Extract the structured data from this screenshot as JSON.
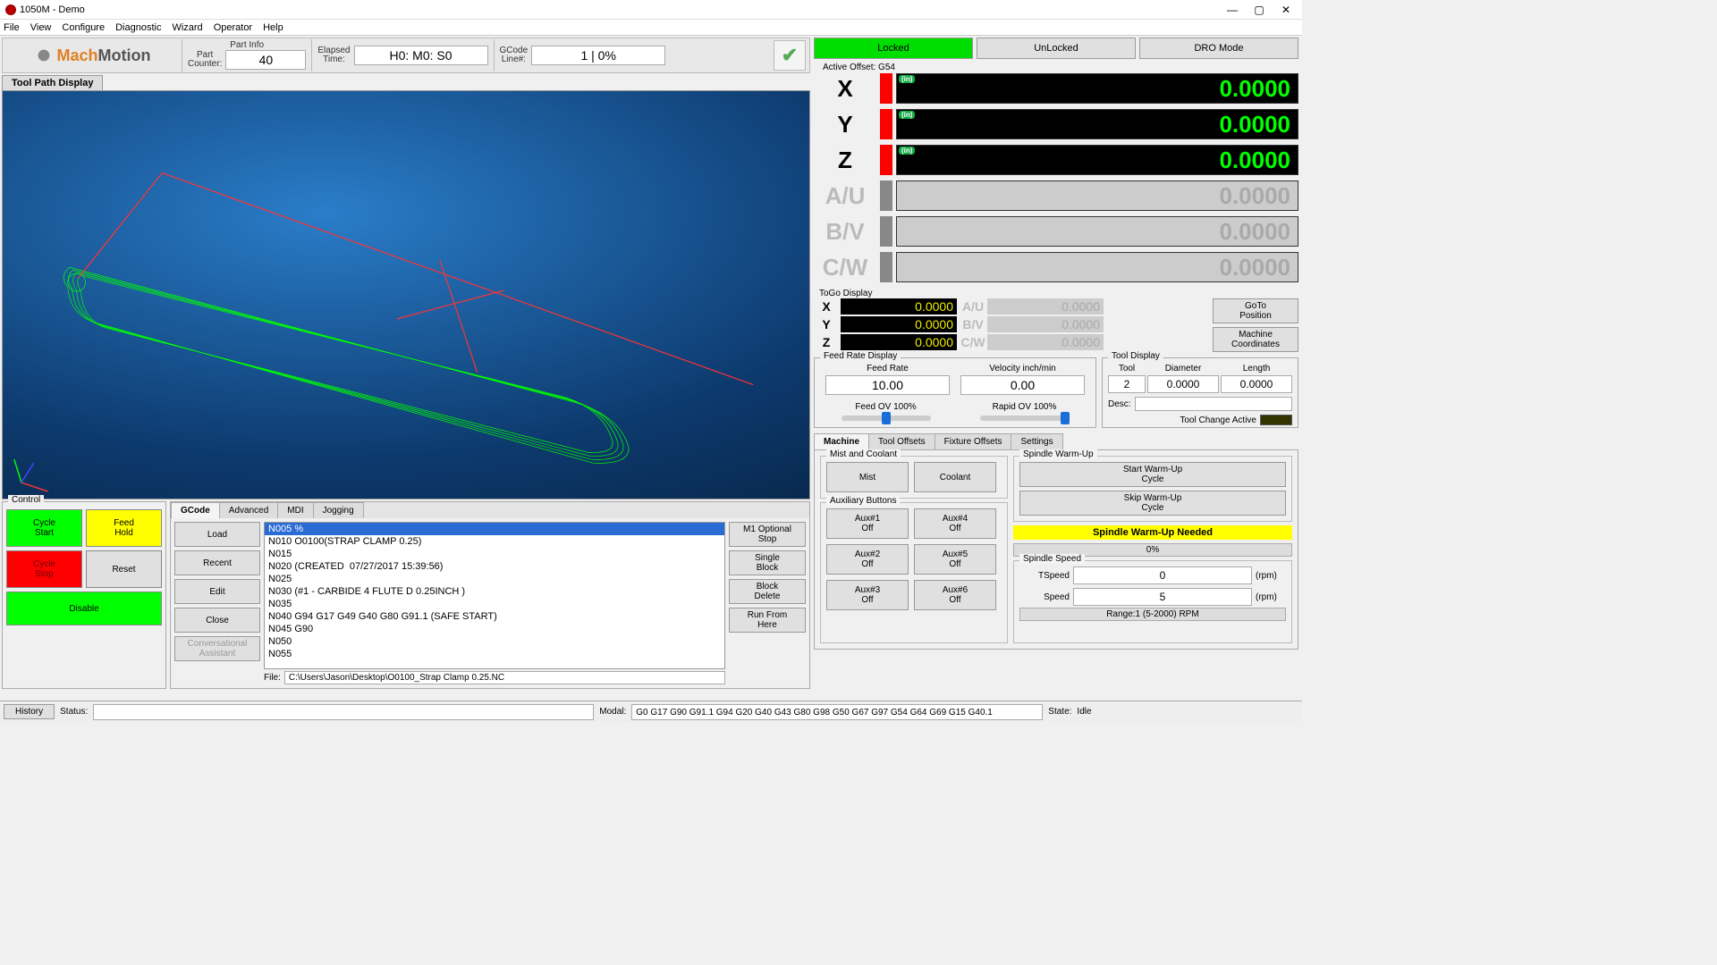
{
  "titlebar": {
    "title": "1050M - Demo"
  },
  "menubar": [
    "File",
    "View",
    "Configure",
    "Diagnostic",
    "Wizard",
    "Operator",
    "Help"
  ],
  "logo": {
    "orange": "Mach",
    "grey": "Motion"
  },
  "info": {
    "part_group": "Part Info",
    "part_counter_lbl": "Part\nCounter:",
    "part_counter_val": "40",
    "elapsed_lbl": "Elapsed\nTime:",
    "elapsed_val": "H0: M0: S0",
    "gcode_line_lbl": "GCode\nLine#:",
    "gcode_line_val": "1 | 0%"
  },
  "toolpath_tab": "Tool Path Display",
  "control": {
    "title": "Control",
    "cycle_start": "Cycle\nStart",
    "feed_hold": "Feed\nHold",
    "cycle_stop": "Cycle\nStop",
    "reset": "Reset",
    "disable": "Disable"
  },
  "gcode": {
    "tabs": [
      "GCode",
      "Advanced",
      "MDI",
      "Jogging"
    ],
    "left_btns": [
      "Load",
      "Recent",
      "Edit",
      "Close",
      "Conversational\nAssistant"
    ],
    "right_btns": [
      "M1 Optional\nStop",
      "Single\nBlock",
      "Block\nDelete",
      "Run From\nHere"
    ],
    "lines": [
      "N005 %",
      "N010 O0100(STRAP CLAMP 0.25)",
      "N015",
      "N020 (CREATED  07/27/2017 15:39:56)",
      "N025",
      "N030 (#1 - CARBIDE 4 FLUTE D 0.25INCH )",
      "N035",
      "N040 G94 G17 G49 G40 G80 G91.1 (SAFE START)",
      "N045 G90",
      "N050",
      "N055"
    ],
    "file_lbl": "File:",
    "file_path": "C:\\Users\\Jason\\Desktop\\O0100_Strap Clamp 0.25.NC"
  },
  "topbtns": {
    "locked": "Locked",
    "unlocked": "UnLocked",
    "dro": "DRO Mode"
  },
  "active_offset": "Active Offset: G54",
  "dro": [
    {
      "axis": "X",
      "val": "0.0000",
      "active": true,
      "unit": "(in)"
    },
    {
      "axis": "Y",
      "val": "0.0000",
      "active": true,
      "unit": "(in)"
    },
    {
      "axis": "Z",
      "val": "0.0000",
      "active": true,
      "unit": "(in)"
    },
    {
      "axis": "A/U",
      "val": "0.0000",
      "active": false,
      "unit": ""
    },
    {
      "axis": "B/V",
      "val": "0.0000",
      "active": false,
      "unit": ""
    },
    {
      "axis": "C/W",
      "val": "0.0000",
      "active": false,
      "unit": ""
    }
  ],
  "togo": {
    "title": "ToGo Display",
    "left": [
      {
        "ax": "X",
        "v": "0.0000",
        "active": true
      },
      {
        "ax": "Y",
        "v": "0.0000",
        "active": true
      },
      {
        "ax": "Z",
        "v": "0.0000",
        "active": true
      }
    ],
    "right": [
      {
        "ax": "A/U",
        "v": "0.0000",
        "active": false
      },
      {
        "ax": "B/V",
        "v": "0.0000",
        "active": false
      },
      {
        "ax": "C/W",
        "v": "0.0000",
        "active": false
      }
    ],
    "btns": [
      "GoTo\nPosition",
      "Machine\nCoordinates"
    ]
  },
  "feed": {
    "title": "Feed Rate Display",
    "feed_lbl": "Feed Rate",
    "feed_val": "10.00",
    "vel_lbl": "Velocity inch/min",
    "vel_val": "0.00",
    "feed_ov": "Feed OV 100%",
    "rapid_ov": "Rapid OV 100%"
  },
  "tool": {
    "title": "Tool Display",
    "tool_lbl": "Tool",
    "dia_lbl": "Diameter",
    "len_lbl": "Length",
    "tool_val": "2",
    "dia_val": "0.0000",
    "len_val": "0.0000",
    "desc_lbl": "Desc:",
    "desc_val": "",
    "tca": "Tool Change Active"
  },
  "bottabs": [
    "Machine",
    "Tool Offsets",
    "Fixture Offsets",
    "Settings"
  ],
  "machine": {
    "mist_title": "Mist and Coolant",
    "mist": "Mist",
    "coolant": "Coolant",
    "aux_title": "Auxiliary Buttons",
    "aux": [
      "Aux#1\nOff",
      "Aux#4\nOff",
      "Aux#2\nOff",
      "Aux#5\nOff",
      "Aux#3\nOff",
      "Aux#6\nOff"
    ]
  },
  "spindle": {
    "warmup_title": "Spindle Warm-Up",
    "start": "Start Warm-Up\nCycle",
    "skip": "Skip Warm-Up\nCycle",
    "warn": "Spindle Warm-Up Needed",
    "pct": "0%",
    "speed_title": "Spindle Speed",
    "tspeed_lbl": "TSpeed",
    "tspeed_val": "0",
    "tspeed_unit": "(rpm)",
    "speed_lbl": "Speed",
    "speed_val": "5",
    "speed_unit": "(rpm)",
    "range": "Range:1 (5-2000) RPM"
  },
  "status": {
    "history": "History",
    "status_lbl": "Status:",
    "modal_lbl": "Modal:",
    "modal_val": "G0 G17 G90 G91.1 G94 G20 G40 G43 G80 G98 G50 G67 G97 G54 G64 G69 G15 G40.1",
    "state_lbl": "State:",
    "state_val": "Idle"
  }
}
